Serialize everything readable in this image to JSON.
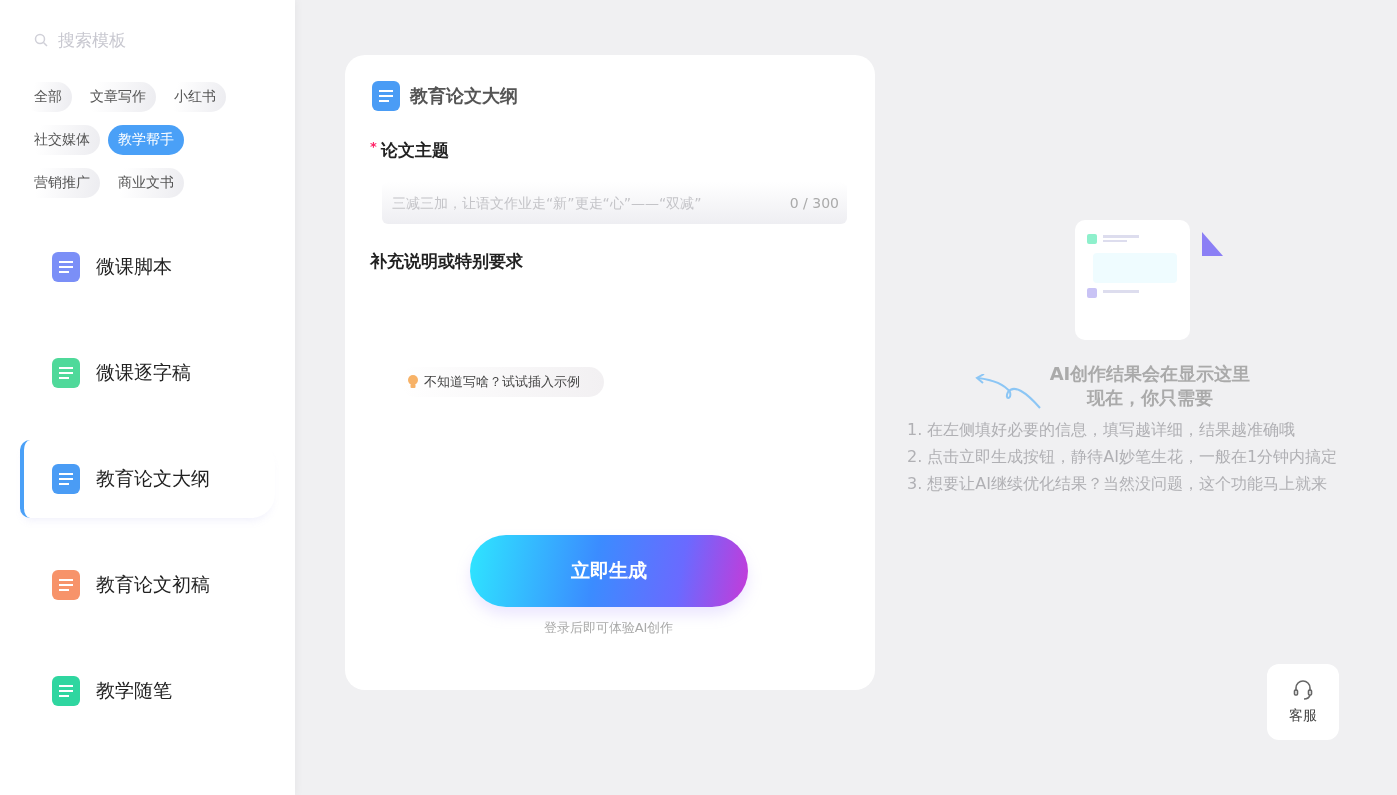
{
  "sidebar": {
    "search": {
      "placeholder": "搜索模板"
    },
    "tags": [
      {
        "label": "全部",
        "selected": false
      },
      {
        "label": "文章写作",
        "selected": false
      },
      {
        "label": "小红书",
        "selected": false
      },
      {
        "label": "社交媒体",
        "selected": false
      },
      {
        "label": "教学帮手",
        "selected": true
      },
      {
        "label": "营销推广",
        "selected": false
      },
      {
        "label": "商业文书",
        "selected": false
      }
    ],
    "items": [
      {
        "label": "微课脚本",
        "selected": false,
        "color": "#7b8ff7"
      },
      {
        "label": "微课逐字稿",
        "selected": false,
        "color": "#4fd99a"
      },
      {
        "label": "教育论文大纲",
        "selected": true,
        "color": "#4a9cf5"
      },
      {
        "label": "教育论文初稿",
        "selected": false,
        "color": "#f7936a"
      },
      {
        "label": "教学随笔",
        "selected": false,
        "color": "#2fd6a0"
      }
    ]
  },
  "form": {
    "title": "教育论文大纲",
    "fields": [
      {
        "label": "论文主题",
        "required_mark": "*",
        "placeholder": "三减三加，让语文作业走“新”更走“心”——“双减”",
        "counter": "0 / 300"
      },
      {
        "label": "补充说明或特别要求"
      }
    ],
    "example_link": "不知道写啥？试试插入示例",
    "submit": "立即生成",
    "login_hint": "登录后即可体验AI创作"
  },
  "result_panel": {
    "heading_lines": [
      "AI创作结果会在显示这里",
      "现在，你只需要"
    ],
    "steps": [
      "1. 在左侧填好必要的信息，填写越详细，结果越准确哦",
      "2. 点击立即生成按钮，静待AI妙笔生花，一般在1分钟内搞定",
      "3. 想要让AI继续优化结果？当然没问题，这个功能马上就来"
    ]
  },
  "support_button": "客服"
}
